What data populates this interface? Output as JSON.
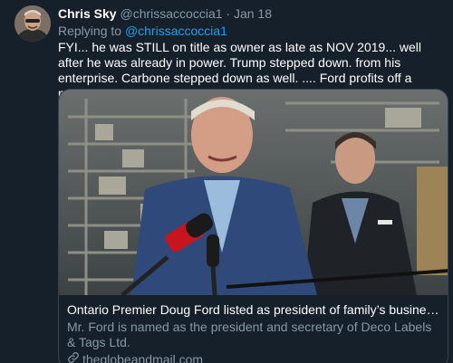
{
  "tweet": {
    "author_name": "Chris Sky",
    "author_handle": "@chrissaccoccia1",
    "separator": "·",
    "date": "Jan 18",
    "reply_prefix": "Replying to",
    "reply_to": "@chrissaccoccia1",
    "text": "FYI... he was STILL on title as owner as late as NOV 2019... well after he was already in power.  Trump stepped down.  from his enterprise. Carbone stepped down as well.  .... Ford profits off a pandemic."
  },
  "card": {
    "title": "Ontario Premier Doug Ford listed as president of family’s business on...",
    "description": "Mr. Ford is named as the president and secretary of Deco Labels & Tags Ltd.",
    "domain": "theglobeandmail.com",
    "link_icon": "link-icon"
  },
  "colors": {
    "background": "#15202b",
    "text_primary": "#ffffff",
    "text_secondary": "#8899a6",
    "link": "#1da1f2",
    "border": "#38444d"
  }
}
